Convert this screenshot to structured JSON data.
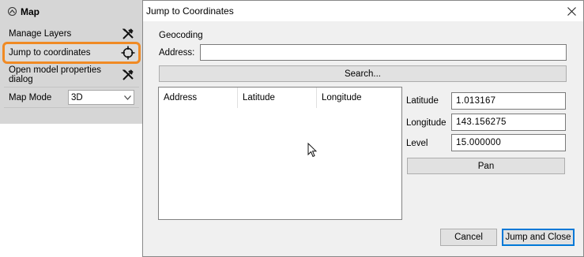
{
  "map_panel": {
    "title": "Map",
    "items": [
      {
        "label": "Manage Layers",
        "icon": "tools-icon"
      },
      {
        "label": "Jump to coordinates",
        "icon": "crosshair-icon"
      },
      {
        "label": "Open model properties dialog",
        "icon": "tools-icon"
      }
    ],
    "map_mode": {
      "label": "Map Mode",
      "value": "3D"
    },
    "highlight_color": "#f08a24"
  },
  "dialog": {
    "title": "Jump to Coordinates",
    "geocoding_label": "Geocoding",
    "address_label": "Address:",
    "address_value": "",
    "search_button": "Search...",
    "results_columns": [
      "Address",
      "Latitude",
      "Longitude"
    ],
    "latitude_label": "Latitude",
    "latitude_value": "1.013167",
    "longitude_label": "Longitude",
    "longitude_value": "143.156275",
    "level_label": "Level",
    "level_value": "15.000000",
    "pan_button": "Pan",
    "cancel_button": "Cancel",
    "ok_button": "Jump and Close",
    "accent_color": "#0078d7"
  }
}
